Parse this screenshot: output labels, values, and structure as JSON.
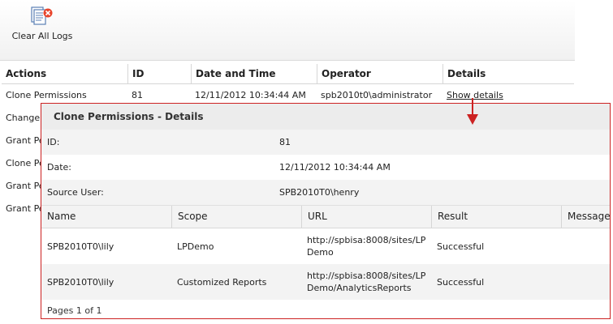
{
  "toolbar": {
    "clear_logs_label": "Clear All Logs",
    "icon": "clear-logs-icon"
  },
  "grid": {
    "columns": [
      "Actions",
      "ID",
      "Date and Time",
      "Operator",
      "Details"
    ],
    "rows": [
      {
        "action": "Clone Permissions",
        "id": "81",
        "date": "12/11/2012 10:34:44 AM",
        "operator": "spb2010t0\\administrator",
        "details": "Show details"
      },
      {
        "action": "Change I"
      },
      {
        "action": "Grant Pe"
      },
      {
        "action": "Clone Pe"
      },
      {
        "action": "Grant Pe"
      },
      {
        "action": "Grant Pe"
      }
    ]
  },
  "popup": {
    "title": "Clone Permissions - Details",
    "fields": [
      {
        "label": "ID:",
        "value": "81"
      },
      {
        "label": "Date:",
        "value": "12/11/2012 10:34:44 AM"
      },
      {
        "label": "Source User:",
        "value": "SPB2010T0\\henry"
      }
    ],
    "table": {
      "columns": [
        "Name",
        "Scope",
        "URL",
        "Result",
        "Message"
      ],
      "rows": [
        {
          "name": "SPB2010T0\\lily",
          "scope": "LPDemo",
          "url": "http://spbisa:8008/sites/LPDemo",
          "result": "Successful"
        },
        {
          "name": "SPB2010T0\\lily",
          "scope": "Customized Reports",
          "url": "http://spbisa:8008/sites/LPDemo/AnalyticsReports",
          "result": "Successful"
        }
      ]
    },
    "pager": "Pages 1 of 1"
  },
  "colors": {
    "popup_border": "#cc2222",
    "arrow": "#cc2222"
  }
}
